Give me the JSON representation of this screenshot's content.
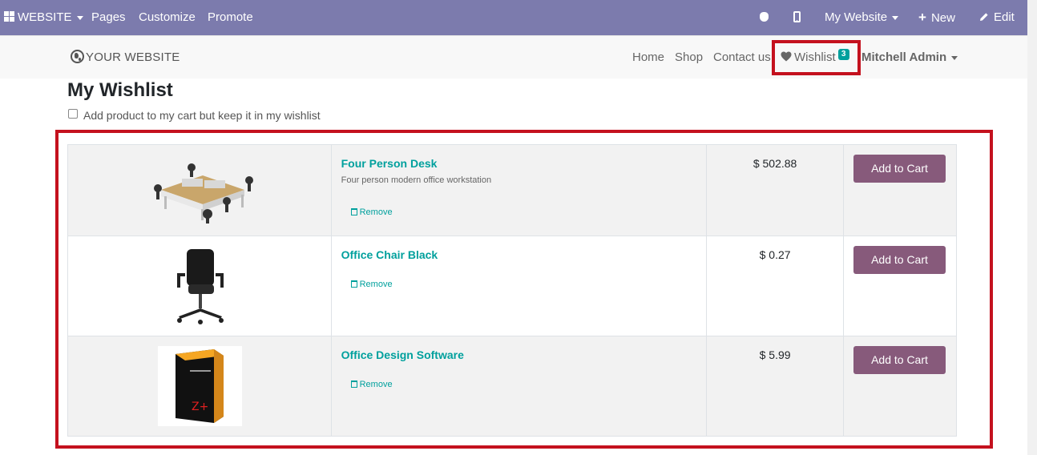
{
  "adminbar": {
    "website_menu": "WEBSITE",
    "pages": "Pages",
    "customize": "Customize",
    "promote": "Promote",
    "my_website": "My Website",
    "new": "New",
    "edit": "Edit",
    "icons": [
      "apps-grid-icon",
      "bug-icon",
      "mobile-icon",
      "plus-icon",
      "pencil-icon"
    ]
  },
  "header": {
    "logo": "YOUR WEBSITE",
    "nav": [
      "Home",
      "Shop",
      "Contact us"
    ],
    "wishlist_label": "Wishlist",
    "wishlist_count": "3",
    "user": "Mitchell Admin"
  },
  "page": {
    "title": "My Wishlist",
    "keep_in_wishlist_label": "Add product to my cart but keep it in my wishlist",
    "keep_in_wishlist_checked": false
  },
  "wishlist": {
    "remove_label": "Remove",
    "add_to_cart_label": "Add to Cart",
    "rows": [
      {
        "name": "Four Person Desk",
        "description": "Four person modern office workstation",
        "price": "$ 502.88"
      },
      {
        "name": "Office Chair Black",
        "description": "",
        "price": "$ 0.27"
      },
      {
        "name": "Office Design Software",
        "description": "",
        "price": "$ 5.99"
      }
    ]
  },
  "colors": {
    "admin_bar": "#7c7bad",
    "accent_teal": "#00a09d",
    "button_purple": "#875a7b",
    "highlight_red": "#c4111e"
  }
}
